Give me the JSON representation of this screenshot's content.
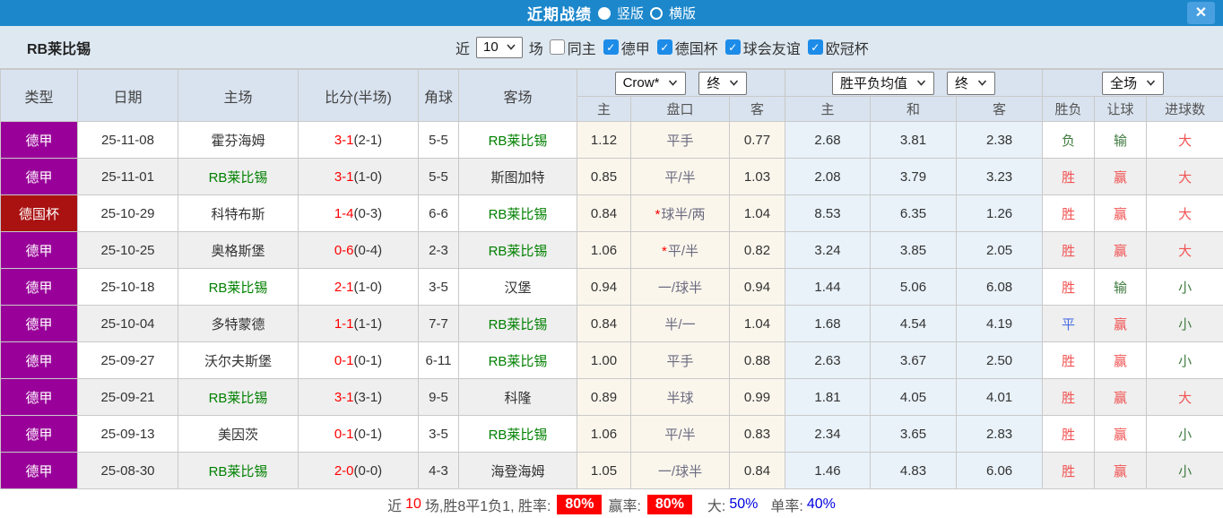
{
  "colors": {
    "titlebar_blue": "#1c87cb",
    "close_button_blue": "#49a0e0",
    "bundesliga_purple": "#990099",
    "dfb_pokal_red": "#aa1111",
    "team_green": "#008000",
    "score_red": "#ff0000",
    "win_red": "#f15353",
    "lose_green": "#417c41",
    "draw_blue": "#4a6ee0",
    "handicap_cream_bg": "#fbf6ec",
    "avg_blue_bg": "#e9f2f9",
    "badge_red": "#ff0000",
    "percent_blue": "#0000e0"
  },
  "titlebar": {
    "title": "近期战绩",
    "vertical_label": "竖版",
    "horizontal_label": "横版",
    "vertical_selected": true,
    "close_icon": "✕"
  },
  "filterbar": {
    "team": "RB莱比锡",
    "near_label": "近",
    "matches_value": "10",
    "matches_unit": "场",
    "checkboxes": [
      {
        "name": "same-home",
        "label": "同主",
        "checked": false
      },
      {
        "name": "bundesliga",
        "label": "德甲",
        "checked": true
      },
      {
        "name": "dfb-pokal",
        "label": "德国杯",
        "checked": true
      },
      {
        "name": "club-friendly",
        "label": "球会友谊",
        "checked": true
      },
      {
        "name": "champions-league",
        "label": "欧冠杯",
        "checked": true
      }
    ]
  },
  "table": {
    "headers": {
      "type": "类型",
      "date": "日期",
      "home": "主场",
      "score": "比分(半场)",
      "corner": "角球",
      "away": "客场",
      "dropdown_company": "Crow*",
      "dropdown_final1": "终",
      "dropdown_avg": "胜平负均值",
      "dropdown_final2": "终",
      "dropdown_fulltime": "全场",
      "odds_sub": [
        "主",
        "盘口",
        "客"
      ],
      "avg_sub": [
        "主",
        "和",
        "客"
      ],
      "result_sub": [
        "胜负",
        "让球",
        "进球数"
      ]
    },
    "rows": [
      {
        "league": "德甲",
        "league_color": "#990099",
        "date": "25-11-08",
        "home": "霍芬海姆",
        "home_is_focus": false,
        "score": "3-1",
        "half": "(2-1)",
        "corners": "5-5",
        "away": "RB莱比锡",
        "away_is_focus": true,
        "star": false,
        "odds": [
          "1.12",
          "平手",
          "0.77"
        ],
        "avg": [
          "2.68",
          "3.81",
          "2.38"
        ],
        "wdl": {
          "t": "负",
          "c": "green"
        },
        "hc": {
          "t": "输",
          "c": "green"
        },
        "go": {
          "t": "大",
          "c": "red"
        }
      },
      {
        "league": "德甲",
        "league_color": "#990099",
        "date": "25-11-01",
        "home": "RB莱比锡",
        "home_is_focus": true,
        "score": "3-1",
        "half": "(1-0)",
        "corners": "5-5",
        "away": "斯图加特",
        "away_is_focus": false,
        "star": false,
        "odds": [
          "0.85",
          "平/半",
          "1.03"
        ],
        "avg": [
          "2.08",
          "3.79",
          "3.23"
        ],
        "wdl": {
          "t": "胜",
          "c": "red"
        },
        "hc": {
          "t": "赢",
          "c": "red"
        },
        "go": {
          "t": "大",
          "c": "red"
        }
      },
      {
        "league": "德国杯",
        "league_color": "#aa1111",
        "date": "25-10-29",
        "home": "科特布斯",
        "home_is_focus": false,
        "score": "1-4",
        "half": "(0-3)",
        "corners": "6-6",
        "away": "RB莱比锡",
        "away_is_focus": true,
        "star": true,
        "odds": [
          "0.84",
          "球半/两",
          "1.04"
        ],
        "avg": [
          "8.53",
          "6.35",
          "1.26"
        ],
        "wdl": {
          "t": "胜",
          "c": "red"
        },
        "hc": {
          "t": "赢",
          "c": "red"
        },
        "go": {
          "t": "大",
          "c": "red"
        }
      },
      {
        "league": "德甲",
        "league_color": "#990099",
        "date": "25-10-25",
        "home": "奥格斯堡",
        "home_is_focus": false,
        "score": "0-6",
        "half": "(0-4)",
        "corners": "2-3",
        "away": "RB莱比锡",
        "away_is_focus": true,
        "star": true,
        "odds": [
          "1.06",
          "平/半",
          "0.82"
        ],
        "avg": [
          "3.24",
          "3.85",
          "2.05"
        ],
        "wdl": {
          "t": "胜",
          "c": "red"
        },
        "hc": {
          "t": "赢",
          "c": "red"
        },
        "go": {
          "t": "大",
          "c": "red"
        }
      },
      {
        "league": "德甲",
        "league_color": "#990099",
        "date": "25-10-18",
        "home": "RB莱比锡",
        "home_is_focus": true,
        "score": "2-1",
        "half": "(1-0)",
        "corners": "3-5",
        "away": "汉堡",
        "away_is_focus": false,
        "star": false,
        "odds": [
          "0.94",
          "一/球半",
          "0.94"
        ],
        "avg": [
          "1.44",
          "5.06",
          "6.08"
        ],
        "wdl": {
          "t": "胜",
          "c": "red"
        },
        "hc": {
          "t": "输",
          "c": "green"
        },
        "go": {
          "t": "小",
          "c": "green"
        }
      },
      {
        "league": "德甲",
        "league_color": "#990099",
        "date": "25-10-04",
        "home": "多特蒙德",
        "home_is_focus": false,
        "score": "1-1",
        "half": "(1-1)",
        "corners": "7-7",
        "away": "RB莱比锡",
        "away_is_focus": true,
        "star": false,
        "odds": [
          "0.84",
          "半/一",
          "1.04"
        ],
        "avg": [
          "1.68",
          "4.54",
          "4.19"
        ],
        "wdl": {
          "t": "平",
          "c": "blue"
        },
        "hc": {
          "t": "赢",
          "c": "red"
        },
        "go": {
          "t": "小",
          "c": "green"
        }
      },
      {
        "league": "德甲",
        "league_color": "#990099",
        "date": "25-09-27",
        "home": "沃尔夫斯堡",
        "home_is_focus": false,
        "score": "0-1",
        "half": "(0-1)",
        "corners": "6-11",
        "away": "RB莱比锡",
        "away_is_focus": true,
        "star": false,
        "odds": [
          "1.00",
          "平手",
          "0.88"
        ],
        "avg": [
          "2.63",
          "3.67",
          "2.50"
        ],
        "wdl": {
          "t": "胜",
          "c": "red"
        },
        "hc": {
          "t": "赢",
          "c": "red"
        },
        "go": {
          "t": "小",
          "c": "green"
        }
      },
      {
        "league": "德甲",
        "league_color": "#990099",
        "date": "25-09-21",
        "home": "RB莱比锡",
        "home_is_focus": true,
        "score": "3-1",
        "half": "(3-1)",
        "corners": "9-5",
        "away": "科隆",
        "away_is_focus": false,
        "star": false,
        "odds": [
          "0.89",
          "半球",
          "0.99"
        ],
        "avg": [
          "1.81",
          "4.05",
          "4.01"
        ],
        "wdl": {
          "t": "胜",
          "c": "red"
        },
        "hc": {
          "t": "赢",
          "c": "red"
        },
        "go": {
          "t": "大",
          "c": "red"
        }
      },
      {
        "league": "德甲",
        "league_color": "#990099",
        "date": "25-09-13",
        "home": "美因茨",
        "home_is_focus": false,
        "score": "0-1",
        "half": "(0-1)",
        "corners": "3-5",
        "away": "RB莱比锡",
        "away_is_focus": true,
        "star": false,
        "odds": [
          "1.06",
          "平/半",
          "0.83"
        ],
        "avg": [
          "2.34",
          "3.65",
          "2.83"
        ],
        "wdl": {
          "t": "胜",
          "c": "red"
        },
        "hc": {
          "t": "赢",
          "c": "red"
        },
        "go": {
          "t": "小",
          "c": "green"
        }
      },
      {
        "league": "德甲",
        "league_color": "#990099",
        "date": "25-08-30",
        "home": "RB莱比锡",
        "home_is_focus": true,
        "score": "2-0",
        "half": "(0-0)",
        "corners": "4-3",
        "away": "海登海姆",
        "away_is_focus": false,
        "star": false,
        "odds": [
          "1.05",
          "一/球半",
          "0.84"
        ],
        "avg": [
          "1.46",
          "4.83",
          "6.06"
        ],
        "wdl": {
          "t": "胜",
          "c": "red"
        },
        "hc": {
          "t": "赢",
          "c": "red"
        },
        "go": {
          "t": "小",
          "c": "green"
        }
      }
    ]
  },
  "summary": {
    "near_label": "近",
    "count": "10",
    "middle_text": "场,胜8平1负1, 胜率:",
    "win_rate": "80%",
    "ying_label": "赢率:",
    "ying_rate": "80%",
    "big_label": "大:",
    "big_value": "50%",
    "single_label": "单率:",
    "single_value": "40%"
  }
}
